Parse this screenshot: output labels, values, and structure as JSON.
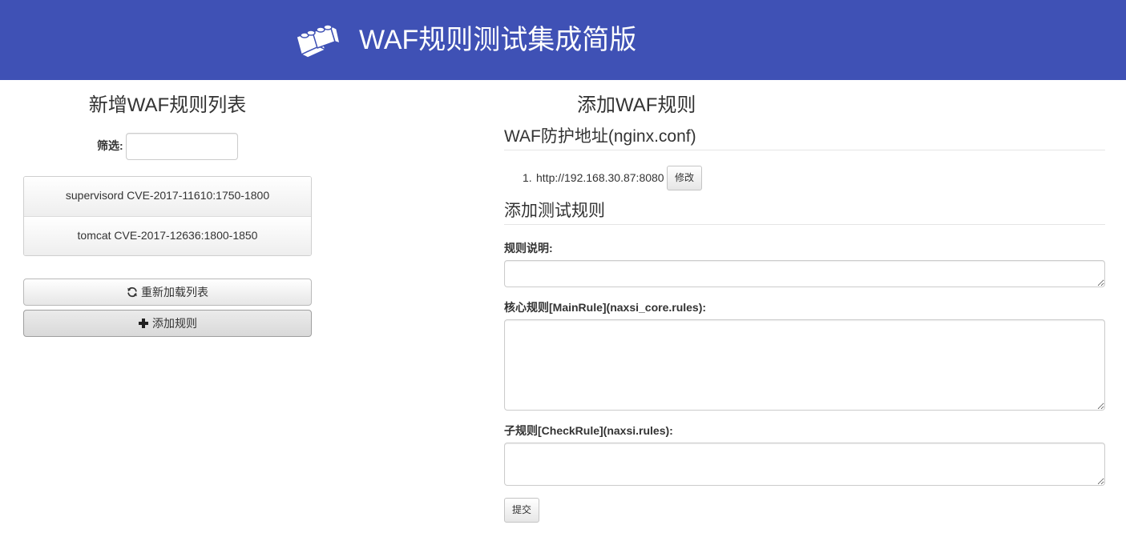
{
  "header": {
    "title": "WAF规则测试集成简版",
    "logo_icon": "lego-bricks-icon",
    "bg_color": "#3f51b5"
  },
  "left": {
    "title": "新增WAF规则列表",
    "filter_label": "筛选:",
    "filter_value": "",
    "rules": [
      {
        "label": "supervisord CVE-2017-11610:1750-1800"
      },
      {
        "label": "tomcat CVE-2017-12636:1800-1850"
      }
    ],
    "reload_button": {
      "label": "重新加载列表",
      "icon": "refresh-icon"
    },
    "add_button": {
      "label": "添加规则",
      "icon": "plus-icon"
    }
  },
  "right": {
    "title": "添加WAF规则",
    "nginx_section": {
      "heading": "WAF防护地址(nginx.conf)",
      "addresses": [
        {
          "num": "1.",
          "url": "http://192.168.30.87:8080"
        }
      ],
      "edit_label": "修改"
    },
    "test_section": {
      "heading": "添加测试规则",
      "desc_label": "规则说明:",
      "core_label": "核心规则[MainRule](naxsi_core.rules):",
      "check_label": "子规则[CheckRule](naxsi.rules):",
      "submit_label": "提交"
    }
  }
}
